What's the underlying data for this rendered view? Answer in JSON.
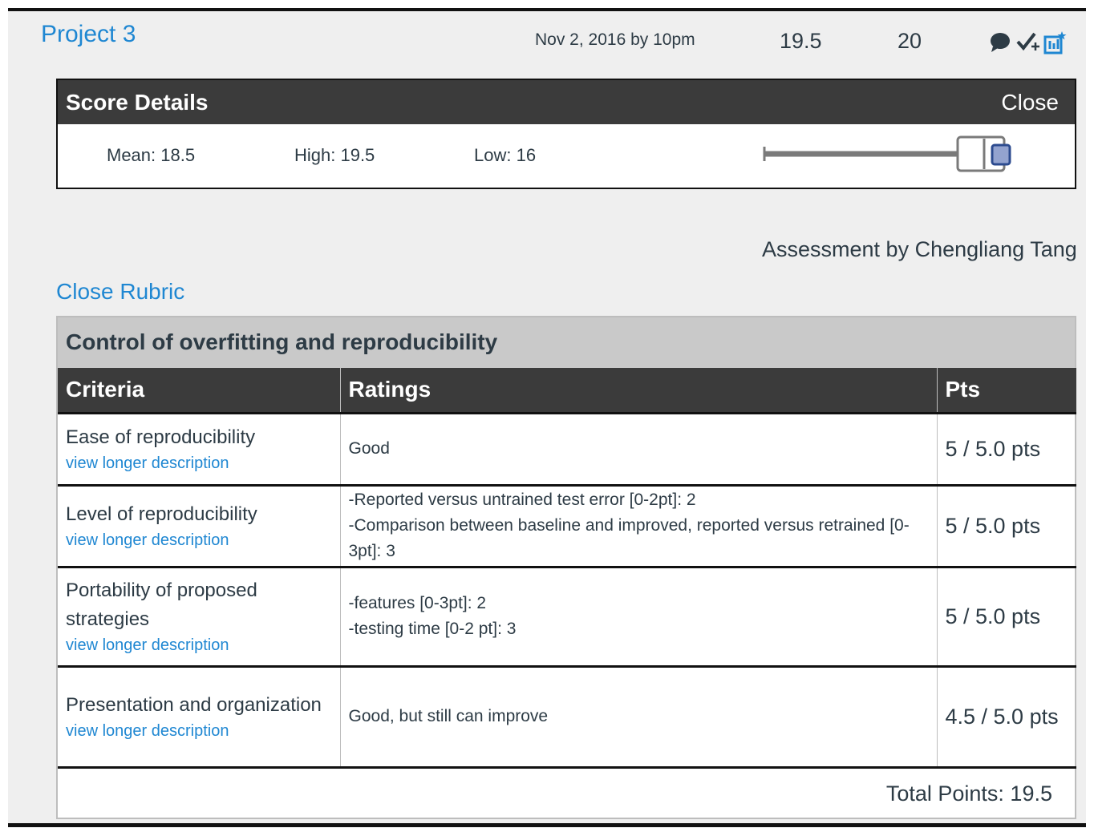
{
  "assignment": {
    "title": "Project 3",
    "due": "Nov 2, 2016 by 10pm",
    "score": "19.5",
    "points_possible": "20"
  },
  "icons": [
    "comment-icon",
    "check-plus-icon",
    "rubric-icon"
  ],
  "score_details": {
    "title": "Score Details",
    "close_label": "Close",
    "mean": "Mean: 18.5",
    "high": "High: 19.5",
    "low": "Low: 16"
  },
  "assessment_by": "Assessment by Chengliang Tang",
  "close_rubric_label": "Close Rubric",
  "rubric": {
    "title": "Control of overfitting and reproducibility",
    "headers": [
      "Criteria",
      "Ratings",
      "Pts"
    ],
    "rows": [
      {
        "criterion": "Ease of reproducibility",
        "link": "view longer description",
        "rating_lines": [
          "Good"
        ],
        "pts": "5 / 5.0 pts"
      },
      {
        "criterion": "Level of reproducibility",
        "link": "view longer description",
        "rating_lines": [
          "-Reported versus untrained test error [0-2pt]: 2",
          "-Comparison between baseline and improved, reported versus retrained [0-3pt]: 3"
        ],
        "pts": "5 / 5.0 pts"
      },
      {
        "criterion": "Portability of proposed strategies",
        "link": "view longer description",
        "rating_lines": [
          "-features [0-3pt]: 2",
          "-testing time [0-2 pt]: 3"
        ],
        "pts": "5 / 5.0 pts"
      },
      {
        "criterion": "Presentation and organization",
        "link": "view longer description",
        "rating_lines": [
          "Good, but still can improve"
        ],
        "pts": "4.5 / 5.0 pts"
      }
    ],
    "total": "Total Points: 19.5"
  },
  "colors": {
    "link": "#1f87d2",
    "header_bg": "#3b3b3b",
    "panel_bg": "#efefef"
  }
}
